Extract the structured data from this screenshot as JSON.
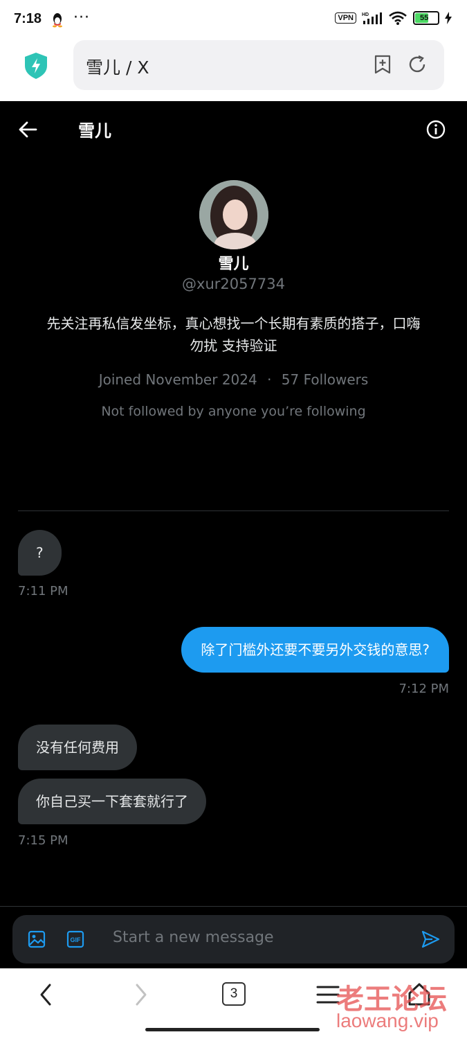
{
  "status_bar": {
    "time": "7:18",
    "dots": "···",
    "vpn": "VPN",
    "battery": "55"
  },
  "browser": {
    "tab_title": "雪儿 / X"
  },
  "header": {
    "name": "雪儿"
  },
  "profile": {
    "name": "雪儿",
    "handle": "@xur2057734",
    "bio": "先关注再私信发坐标，真心想找一个长期有素质的搭子，口嗨勿扰 支持验证",
    "joined": "Joined November 2024",
    "separator": "·",
    "followers": "57 Followers",
    "not_followed": "Not followed by anyone you’re following"
  },
  "messages": [
    {
      "side": "in",
      "text": "?"
    },
    {
      "side": "out",
      "text": "除了门槛外还要不要另外交钱的意思?"
    },
    {
      "side": "in",
      "text": "没有任何费用"
    },
    {
      "side": "in",
      "text": "你自己买一下套套就行了"
    }
  ],
  "timestamps": [
    "7:11 PM",
    "7:12 PM",
    "7:15 PM"
  ],
  "composer": {
    "placeholder": "Start a new message"
  },
  "bottom_nav": {
    "tab_count": "3"
  },
  "watermark": {
    "line1": "老王论坛",
    "line2": "laowang.vip"
  },
  "colors": {
    "accent": "#1d9bf0",
    "incoming_bubble": "#2f3336",
    "background": "#000000"
  }
}
